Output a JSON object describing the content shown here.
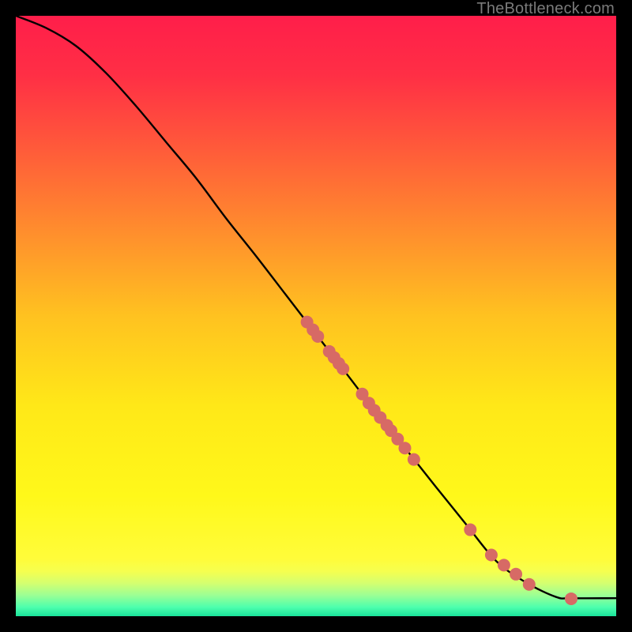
{
  "attribution": "TheBottleneck.com",
  "chart_data": {
    "type": "line",
    "title": "",
    "xlabel": "",
    "ylabel": "",
    "xlim": [
      0,
      100
    ],
    "ylim": [
      0,
      100
    ],
    "grid": false,
    "legend": false,
    "background_gradient_stops": [
      {
        "offset": 0.0,
        "color": "#ff1e4a"
      },
      {
        "offset": 0.1,
        "color": "#ff2f45"
      },
      {
        "offset": 0.22,
        "color": "#ff5a3a"
      },
      {
        "offset": 0.35,
        "color": "#ff8a2e"
      },
      {
        "offset": 0.5,
        "color": "#ffc220"
      },
      {
        "offset": 0.65,
        "color": "#ffe818"
      },
      {
        "offset": 0.8,
        "color": "#fff81a"
      },
      {
        "offset": 0.905,
        "color": "#fffc3a"
      },
      {
        "offset": 0.925,
        "color": "#f6ff4f"
      },
      {
        "offset": 0.945,
        "color": "#d4ff70"
      },
      {
        "offset": 0.965,
        "color": "#9cff94"
      },
      {
        "offset": 0.985,
        "color": "#4dffad"
      },
      {
        "offset": 1.0,
        "color": "#19e29a"
      }
    ],
    "curve": {
      "x": [
        0,
        5,
        10,
        15,
        20,
        25,
        30,
        35,
        40,
        45,
        50,
        55,
        60,
        65,
        70,
        75,
        80,
        85,
        90,
        92.5,
        100
      ],
      "y": [
        100,
        98,
        95,
        90.5,
        85,
        79,
        73,
        66.3,
        60,
        53.5,
        47,
        40.5,
        34,
        27.8,
        21.5,
        15.3,
        9.2,
        5.6,
        3.2,
        3,
        3
      ]
    },
    "markers": {
      "color": "#d76a65",
      "radius": 8,
      "points": [
        {
          "x": 48.5,
          "y": 49.0
        },
        {
          "x": 49.5,
          "y": 47.7
        },
        {
          "x": 50.3,
          "y": 46.6
        },
        {
          "x": 52.2,
          "y": 44.1
        },
        {
          "x": 53.0,
          "y": 43.1
        },
        {
          "x": 53.8,
          "y": 42.1
        },
        {
          "x": 54.5,
          "y": 41.2
        },
        {
          "x": 57.7,
          "y": 37.0
        },
        {
          "x": 58.8,
          "y": 35.5
        },
        {
          "x": 59.7,
          "y": 34.3
        },
        {
          "x": 60.7,
          "y": 33.1
        },
        {
          "x": 61.8,
          "y": 31.8
        },
        {
          "x": 62.5,
          "y": 30.9
        },
        {
          "x": 63.6,
          "y": 29.5
        },
        {
          "x": 64.8,
          "y": 28.0
        },
        {
          "x": 66.3,
          "y": 26.1
        },
        {
          "x": 75.7,
          "y": 14.4
        },
        {
          "x": 79.2,
          "y": 10.2
        },
        {
          "x": 81.3,
          "y": 8.5
        },
        {
          "x": 83.3,
          "y": 7.0
        },
        {
          "x": 85.5,
          "y": 5.3
        },
        {
          "x": 92.5,
          "y": 2.9
        }
      ]
    }
  }
}
